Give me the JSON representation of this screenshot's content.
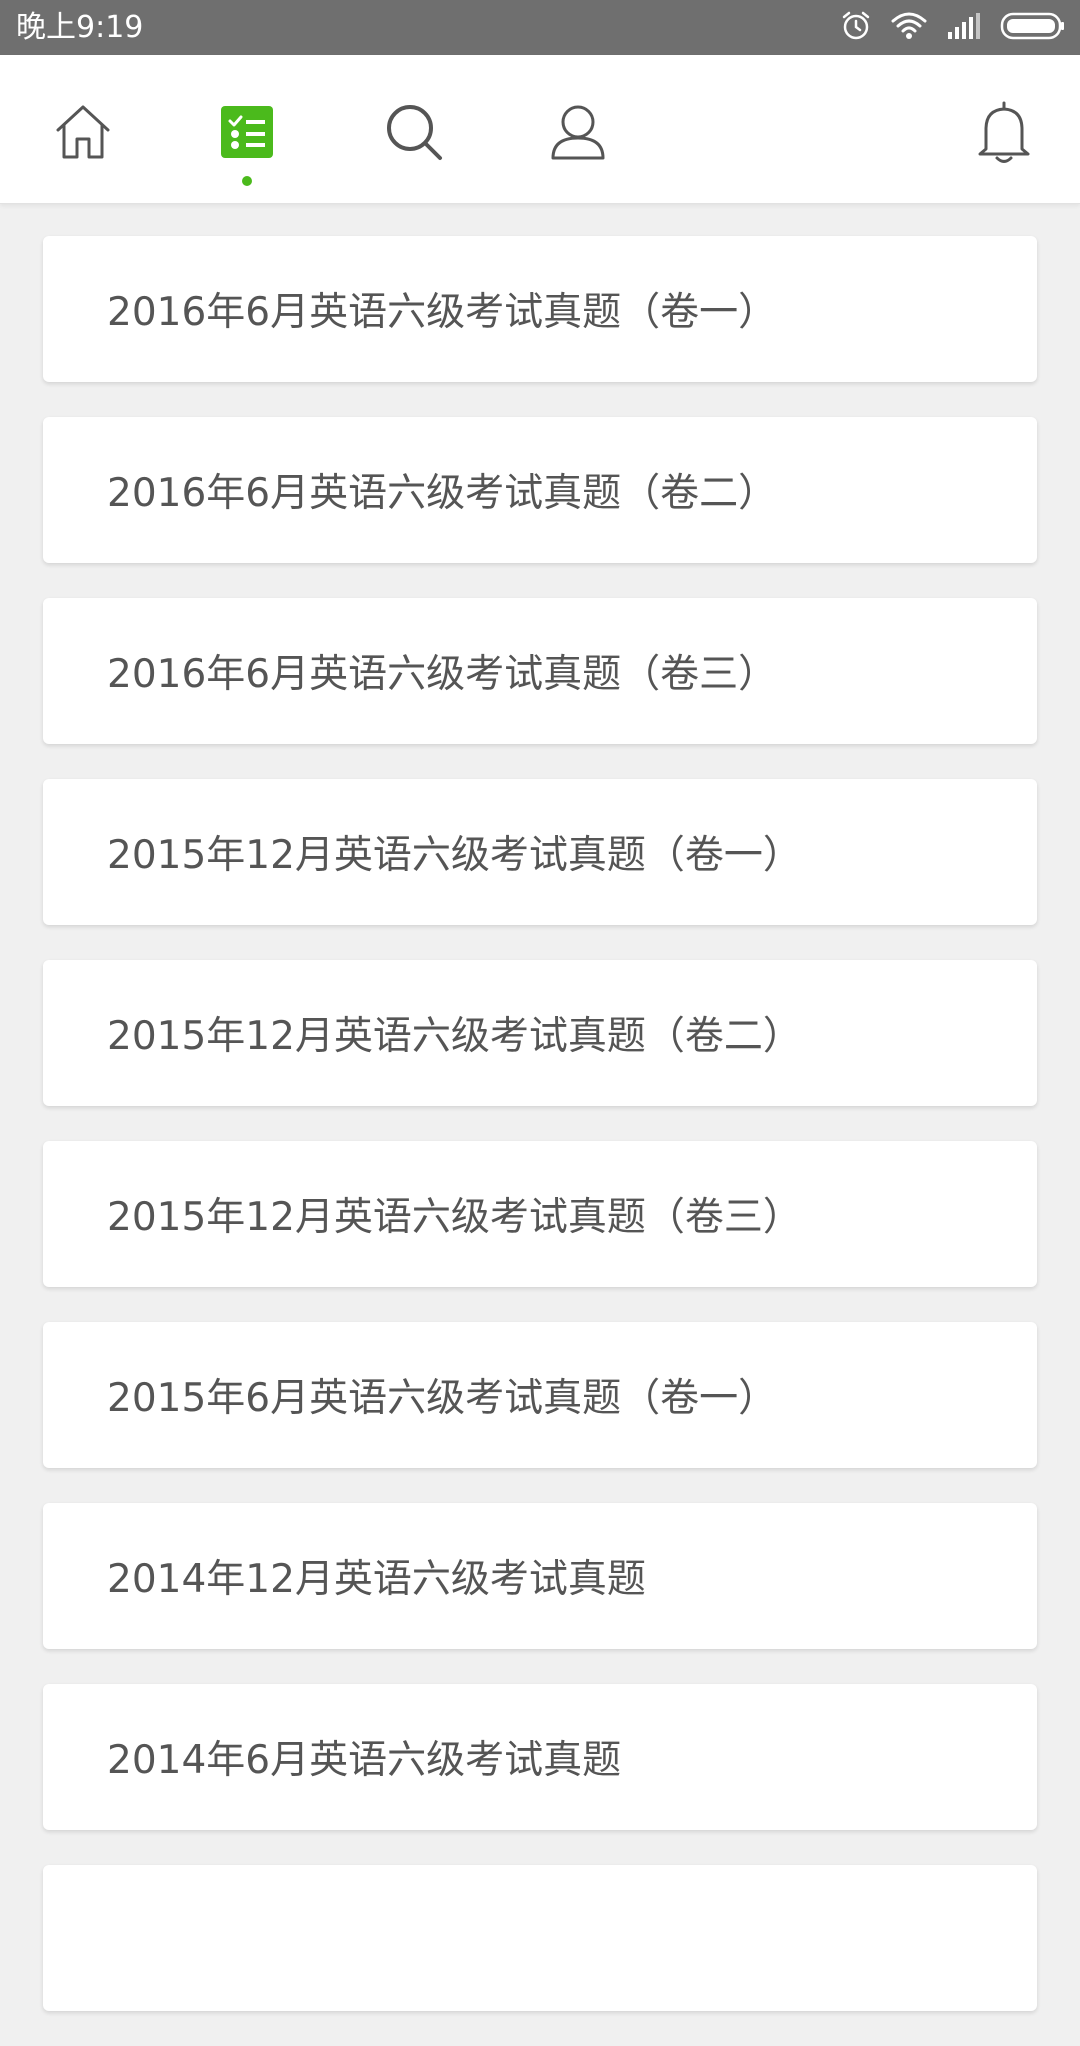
{
  "status_bar": {
    "time": "晚上9:19"
  },
  "nav": {
    "active_color": "#4bba1c",
    "items": [
      {
        "name": "home",
        "icon": "home-icon"
      },
      {
        "name": "exam-list",
        "icon": "checklist-icon",
        "active": true
      },
      {
        "name": "search",
        "icon": "search-icon"
      },
      {
        "name": "profile",
        "icon": "user-icon"
      },
      {
        "name": "notifications",
        "icon": "bell-icon"
      }
    ]
  },
  "papers": [
    {
      "title": "2016年6月英语六级考试真题（卷一）"
    },
    {
      "title": "2016年6月英语六级考试真题（卷二）"
    },
    {
      "title": "2016年6月英语六级考试真题（卷三）"
    },
    {
      "title": "2015年12月英语六级考试真题（卷一）"
    },
    {
      "title": "2015年12月英语六级考试真题（卷二）"
    },
    {
      "title": "2015年12月英语六级考试真题（卷三）"
    },
    {
      "title": "2015年6月英语六级考试真题（卷一）"
    },
    {
      "title": "2014年12月英语六级考试真题"
    },
    {
      "title": "2014年6月英语六级考试真题"
    },
    {
      "title": ""
    }
  ]
}
